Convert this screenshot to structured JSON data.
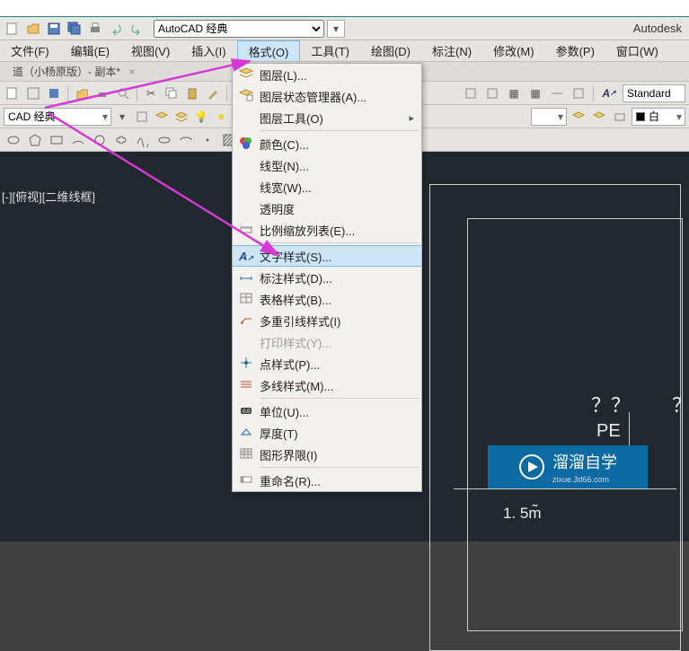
{
  "app": {
    "brand": "Autodesk"
  },
  "workspace": {
    "name": "AutoCAD 经典"
  },
  "qat_icons": [
    "new",
    "open",
    "save",
    "saveall",
    "print",
    "undo",
    "redo"
  ],
  "menubar": [
    {
      "label": "文件(F)"
    },
    {
      "label": "编辑(E)"
    },
    {
      "label": "视图(V)"
    },
    {
      "label": "插入(I)"
    },
    {
      "label": "格式(O)",
      "open": true
    },
    {
      "label": "工具(T)"
    },
    {
      "label": "绘图(D)"
    },
    {
      "label": "标注(N)"
    },
    {
      "label": "修改(M)"
    },
    {
      "label": "参数(P)"
    },
    {
      "label": "窗口(W)"
    }
  ],
  "tabs": [
    {
      "label": "道（小杨原版）- 副本*"
    }
  ],
  "text_style_combo": "Standard",
  "layer_dd": "CAD 经典",
  "layer_combo_right": "白",
  "dropdown": {
    "sections": [
      [
        {
          "label": "图层(L)..."
        },
        {
          "label": "图层状态管理器(A)..."
        },
        {
          "label": "图层工具(O)",
          "submenu": true
        }
      ],
      [
        {
          "label": "颜色(C)..."
        },
        {
          "label": "线型(N)..."
        },
        {
          "label": "线宽(W)..."
        },
        {
          "label": "透明度"
        },
        {
          "label": "比例缩放列表(E)..."
        }
      ],
      [
        {
          "label": "文字样式(S)...",
          "hot": true
        },
        {
          "label": "标注样式(D)..."
        },
        {
          "label": "表格样式(B)..."
        },
        {
          "label": "多重引线样式(I)"
        },
        {
          "label": "打印样式(Y)...",
          "disabled": true
        },
        {
          "label": "点样式(P)..."
        },
        {
          "label": "多线样式(M)..."
        }
      ],
      [
        {
          "label": "单位(U)..."
        },
        {
          "label": "厚度(T)"
        },
        {
          "label": "图形界限(I)"
        }
      ],
      [
        {
          "label": "重命名(R)..."
        }
      ]
    ]
  },
  "viewport_label": "二维线框",
  "canvas": {
    "questions": "？？",
    "questions2": "？",
    "pe_text": "PE",
    "bottom_text": "1. 5m̃"
  },
  "logo": {
    "main": "溜溜自学",
    "sub": "zixue.3d66.com"
  }
}
